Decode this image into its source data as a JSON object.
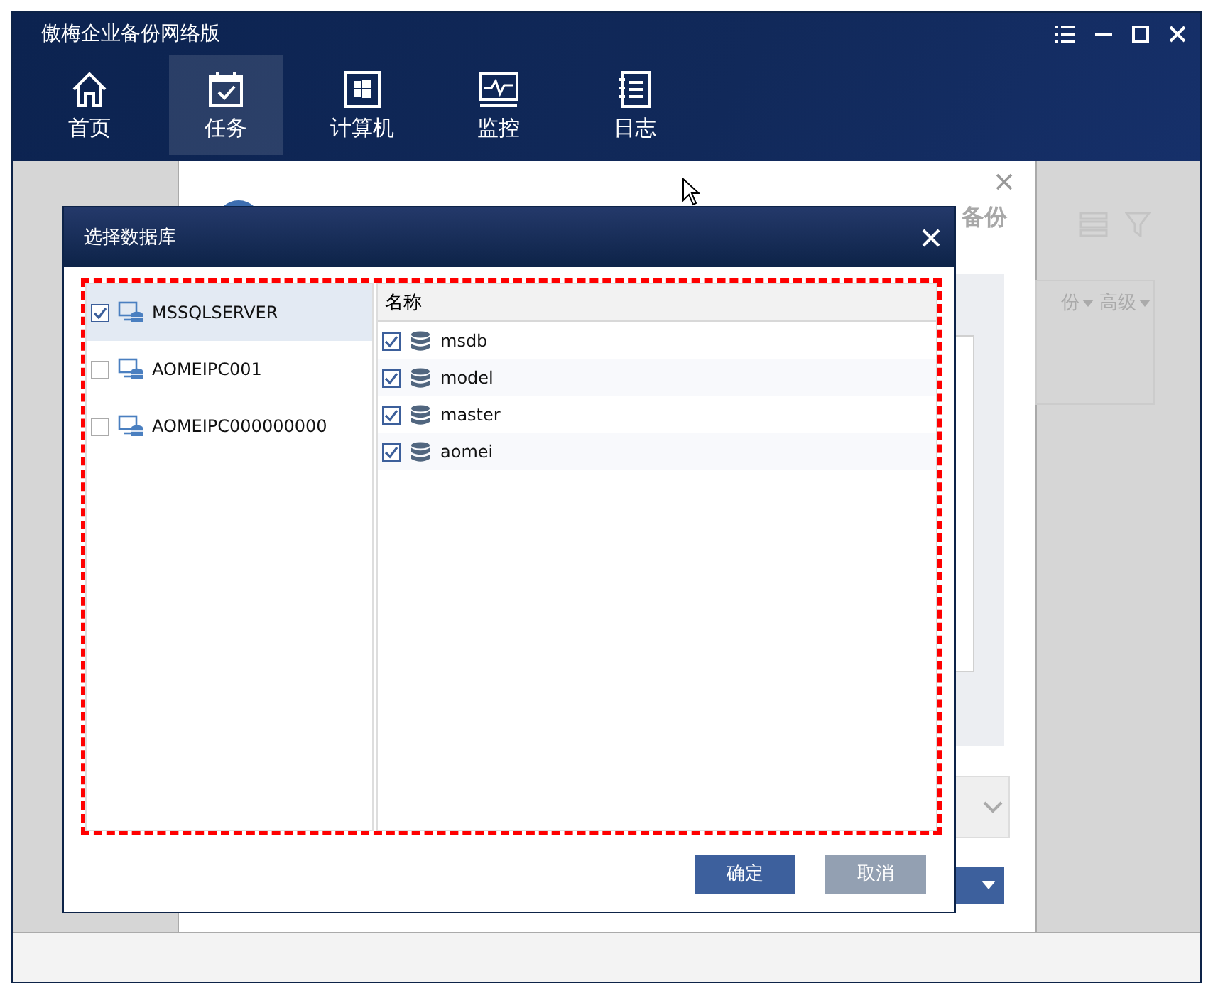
{
  "window": {
    "title": "傲梅企业备份网络版"
  },
  "nav": [
    {
      "label": "首页",
      "kind": "home",
      "selected": false
    },
    {
      "label": "任务",
      "kind": "tasks",
      "selected": true
    },
    {
      "label": "计算机",
      "kind": "computers",
      "selected": false
    },
    {
      "label": "监控",
      "kind": "monitor",
      "selected": false
    },
    {
      "label": "日志",
      "kind": "log",
      "selected": false
    }
  ],
  "background_panel": {
    "title": "备份",
    "column_1": "份",
    "column_2": "高级"
  },
  "dialog": {
    "title": "选择数据库",
    "instances": [
      {
        "name": "MSSQLSERVER",
        "checked": true,
        "selected": true
      },
      {
        "name": "AOMEIPC001",
        "checked": false,
        "selected": false
      },
      {
        "name": "AOMEIPC000000000",
        "checked": false,
        "selected": false
      }
    ],
    "column": "名称",
    "databases": [
      {
        "name": "msdb",
        "checked": true
      },
      {
        "name": "model",
        "checked": true
      },
      {
        "name": "master",
        "checked": true
      },
      {
        "name": "aomei",
        "checked": true
      }
    ],
    "buttons": [
      {
        "label": "确定",
        "kind": "primary"
      },
      {
        "label": "取消",
        "kind": "secondary"
      }
    ]
  }
}
